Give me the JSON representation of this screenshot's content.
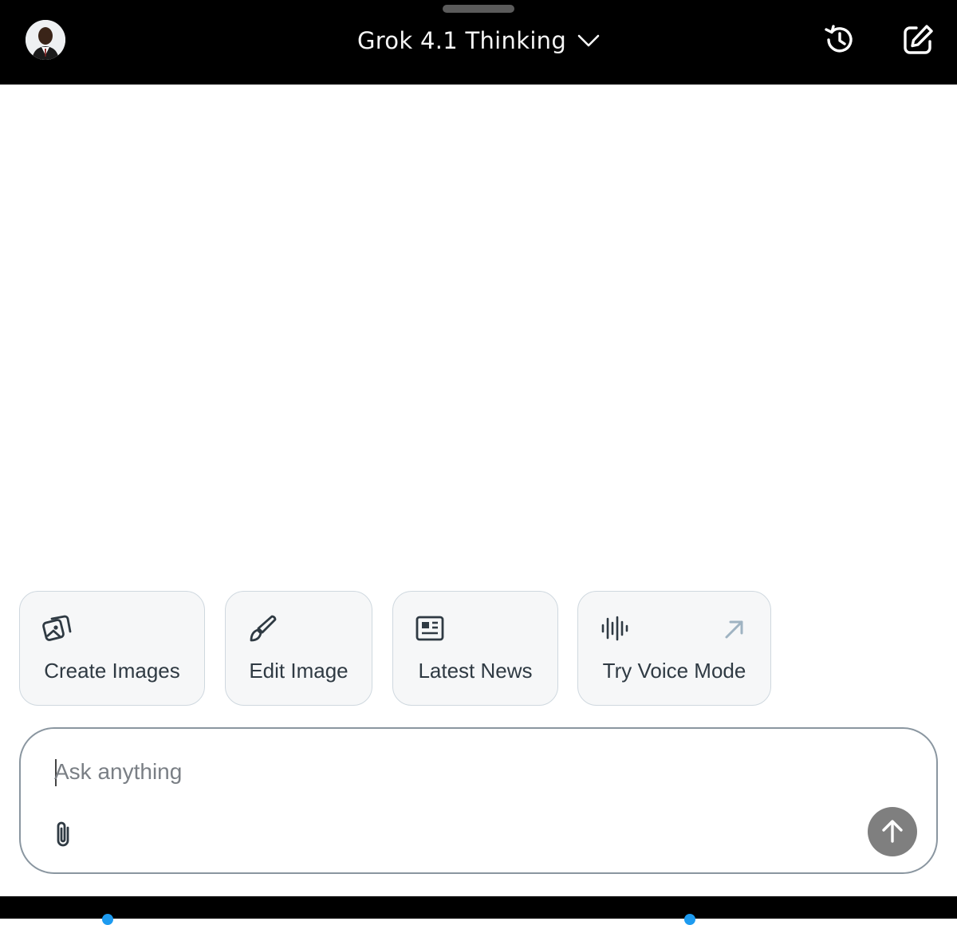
{
  "header": {
    "model_label": "Grok 4.1 Thinking",
    "avatar_icon": "user-avatar",
    "history_icon": "history-icon",
    "compose_icon": "new-chat-compose-icon"
  },
  "suggestions": [
    {
      "label": "Create Images",
      "icon": "images-icon"
    },
    {
      "label": "Edit Image",
      "icon": "paintbrush-icon"
    },
    {
      "label": "Latest News",
      "icon": "newspaper-icon"
    },
    {
      "label": "Try Voice Mode",
      "icon": "waveform-icon",
      "extra_icon": "arrow-up-right-icon"
    }
  ],
  "composer": {
    "placeholder": "Ask anything",
    "value": "",
    "attach_icon": "paperclip-icon",
    "send_icon": "arrow-up-icon"
  },
  "colors": {
    "topbar": "#000000",
    "chip_bg": "#f6f7f8",
    "chip_border": "#cfd8df",
    "send_bg": "#7f7f7f",
    "accent": "#1d9bf0"
  }
}
